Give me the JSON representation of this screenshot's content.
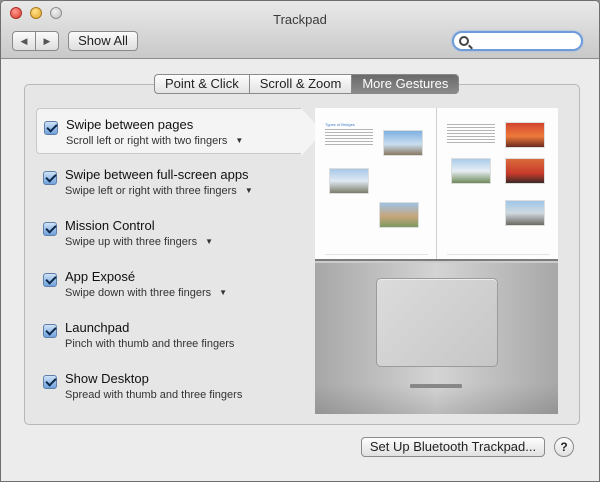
{
  "window": {
    "title": "Trackpad"
  },
  "toolbar": {
    "back_label": "◀",
    "forward_label": "▶",
    "show_all_label": "Show All",
    "search_value": ""
  },
  "tabs": [
    {
      "label": "Point & Click",
      "active": false
    },
    {
      "label": "Scroll & Zoom",
      "active": false
    },
    {
      "label": "More Gestures",
      "active": true
    }
  ],
  "gestures": [
    {
      "title": "Swipe between pages",
      "subtitle": "Scroll left or right with two fingers",
      "checked": true,
      "has_menu": true,
      "selected": true
    },
    {
      "title": "Swipe between full-screen apps",
      "subtitle": "Swipe left or right with three fingers",
      "checked": true,
      "has_menu": true,
      "selected": false
    },
    {
      "title": "Mission Control",
      "subtitle": "Swipe up with three fingers",
      "checked": true,
      "has_menu": true,
      "selected": false
    },
    {
      "title": "App Exposé",
      "subtitle": "Swipe down with three fingers",
      "checked": true,
      "has_menu": true,
      "selected": false
    },
    {
      "title": "Launchpad",
      "subtitle": "Pinch with thumb and three fingers",
      "checked": true,
      "has_menu": false,
      "selected": false
    },
    {
      "title": "Show Desktop",
      "subtitle": "Spread with thumb and three fingers",
      "checked": true,
      "has_menu": false,
      "selected": false
    }
  ],
  "preview": {
    "left_page_title": "Types of Bridges"
  },
  "footer": {
    "bluetooth_label": "Set Up Bluetooth Trackpad...",
    "help_label": "?"
  },
  "colors": {
    "active_tab": "#7a7a7a",
    "checkbox": "#6fa1dc",
    "search_focus": "#6e9cd9"
  },
  "icons": {
    "search": "magnifier",
    "menu": "caret-down",
    "back": "chevron-left",
    "forward": "chevron-right"
  }
}
